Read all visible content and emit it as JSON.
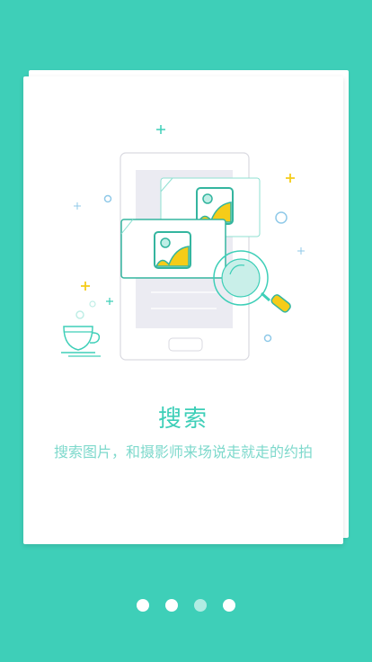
{
  "colors": {
    "background": "#3ecfb8",
    "accent": "#3ecfb8",
    "accent_light": "#7ed9cc",
    "highlight": "#f5cc19"
  },
  "illustration": {
    "name": "search-illustration",
    "icons": [
      "phone-icon",
      "photo-card-icon",
      "magnifier-icon",
      "tea-cup-icon",
      "sparkle-icon"
    ]
  },
  "intro": {
    "title": "搜索",
    "subtitle": "搜索图片，和摄影师来场说走就走的约拍"
  },
  "pager": {
    "count": 4,
    "active_index": 2
  }
}
